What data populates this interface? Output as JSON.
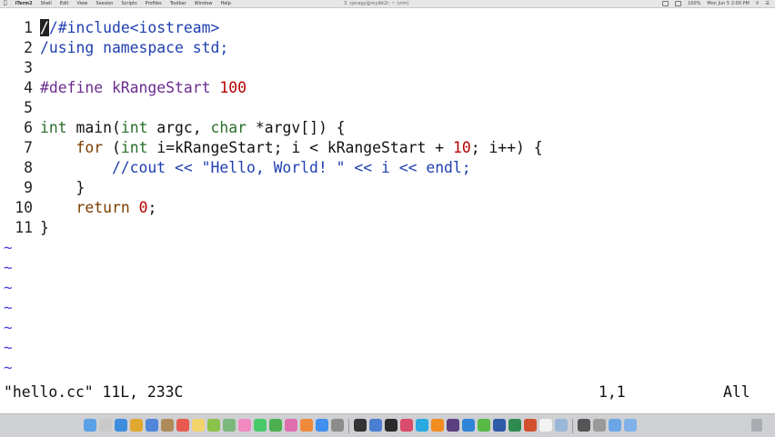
{
  "menubar": {
    "app": "iTerm2",
    "items": [
      "Shell",
      "Edit",
      "View",
      "Session",
      "Scripts",
      "Profiles",
      "Toolbar",
      "Window",
      "Help"
    ],
    "window_title": "3. cpnagy@mylbt2r: ~ (vim)",
    "status_text": "100%",
    "clock": "Mon Jun 5 2:00 PM"
  },
  "editor": {
    "lines": [
      {
        "n": "1",
        "parts": [
          {
            "t": "/",
            "c": "cursor"
          },
          {
            "t": "/#include<iostream>",
            "c": "comment"
          }
        ]
      },
      {
        "n": "2",
        "parts": [
          {
            "t": "/using namespace std;",
            "c": "comment"
          }
        ]
      },
      {
        "n": "3",
        "parts": []
      },
      {
        "n": "4",
        "parts": [
          {
            "t": "#define kRangeStart ",
            "c": "kw-pre"
          },
          {
            "t": "100",
            "c": "num"
          }
        ]
      },
      {
        "n": "5",
        "parts": []
      },
      {
        "n": "6",
        "parts": [
          {
            "t": "int",
            "c": "kw-type"
          },
          {
            "t": " main(",
            "c": ""
          },
          {
            "t": "int",
            "c": "kw-type"
          },
          {
            "t": " argc, ",
            "c": ""
          },
          {
            "t": "char",
            "c": "kw-type"
          },
          {
            "t": " *argv[]) {",
            "c": ""
          }
        ]
      },
      {
        "n": "7",
        "parts": [
          {
            "t": "    ",
            "c": ""
          },
          {
            "t": "for",
            "c": "kw-stmt"
          },
          {
            "t": " (",
            "c": ""
          },
          {
            "t": "int",
            "c": "kw-type"
          },
          {
            "t": " i=kRangeStart; i < kRangeStart + ",
            "c": ""
          },
          {
            "t": "10",
            "c": "num"
          },
          {
            "t": "; i++) {",
            "c": ""
          }
        ]
      },
      {
        "n": "8",
        "parts": [
          {
            "t": "        //cout << \"Hello, World! \" << i << endl;",
            "c": "comment"
          }
        ]
      },
      {
        "n": "9",
        "parts": [
          {
            "t": "    }",
            "c": ""
          }
        ]
      },
      {
        "n": "10",
        "parts": [
          {
            "t": "    ",
            "c": ""
          },
          {
            "t": "return",
            "c": "kw-stmt"
          },
          {
            "t": " ",
            "c": ""
          },
          {
            "t": "0",
            "c": "num"
          },
          {
            "t": ";",
            "c": ""
          }
        ]
      },
      {
        "n": "11",
        "parts": [
          {
            "t": "}",
            "c": ""
          }
        ]
      }
    ],
    "empty_marker": "~",
    "empty_line_count": 7
  },
  "status": {
    "file_info": "\"hello.cc\" 11L, 233C",
    "cursor_position": "1,1",
    "scroll_position": "All"
  },
  "dock": {
    "icons": [
      "finder-icon",
      "launchpad-icon",
      "safari-icon",
      "chrome-icon",
      "mail-icon",
      "contacts-icon",
      "calendar-icon",
      "notes-icon",
      "reminders-icon",
      "maps-icon",
      "photos-icon",
      "messages-icon",
      "facetime-icon",
      "itunes-icon",
      "ibooks-icon",
      "appstore-icon",
      "preferences-icon",
      "terminal-icon",
      "xcode-icon",
      "iterm-icon",
      "music-icon",
      "skype-icon",
      "vlc-icon",
      "slack-icon",
      "dropbox-icon",
      "evernote-icon",
      "word-icon",
      "excel-icon",
      "powerpoint-icon",
      "textedit-icon",
      "preview-icon",
      "activity-icon",
      "calculator-icon",
      "folder-icon",
      "downloads-icon"
    ]
  }
}
